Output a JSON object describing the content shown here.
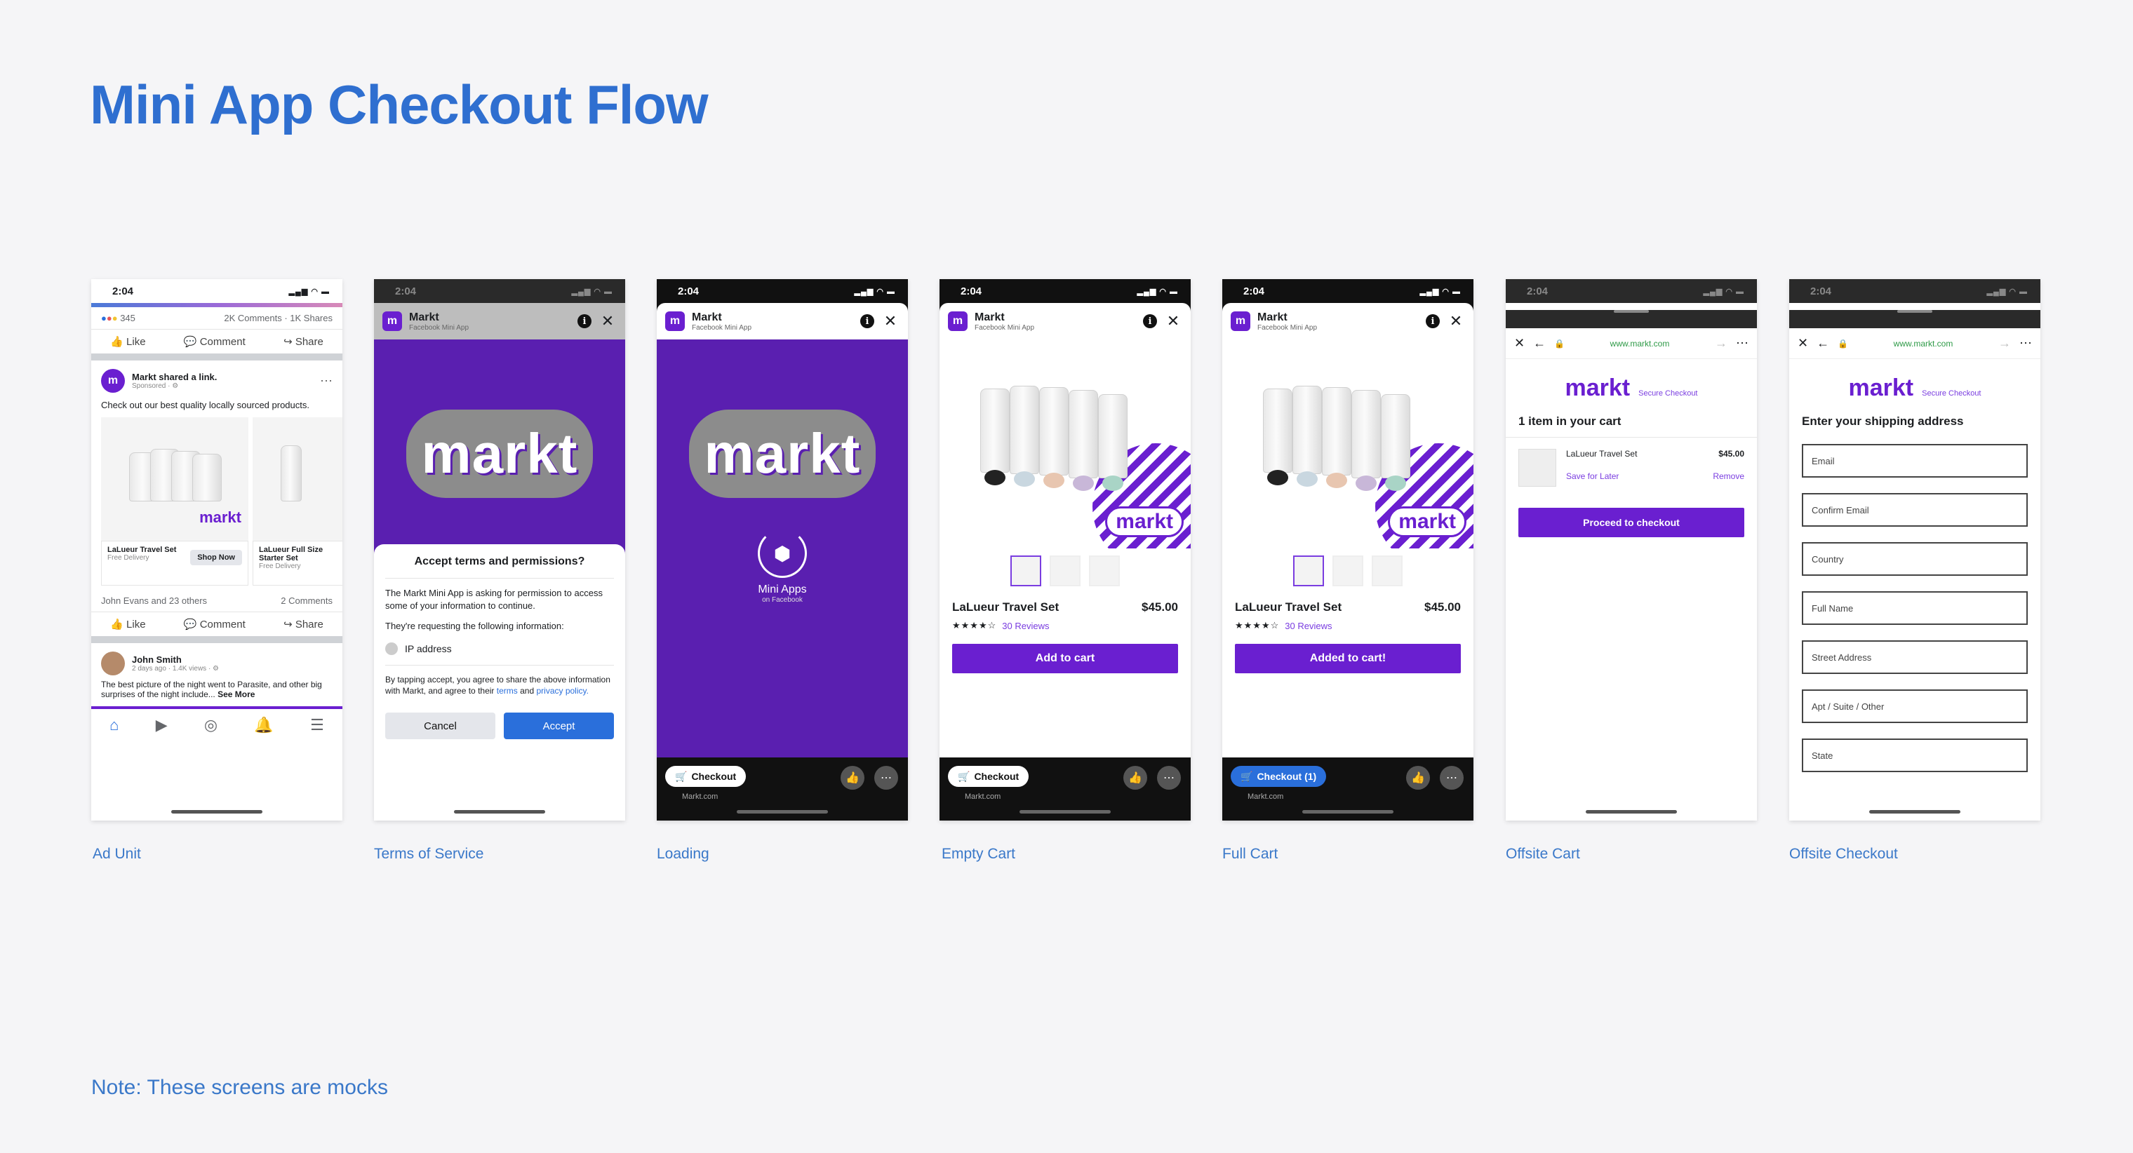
{
  "slide": {
    "title": "Mini App Checkout Flow",
    "note": "Note: These screens are mocks"
  },
  "colors": {
    "accent": "#2f6fd0",
    "brand_purple": "#6a1fd0",
    "fb_blue": "#2a6fdb"
  },
  "captions": [
    "Ad Unit",
    "Terms of Service",
    "Loading",
    "Empty Cart",
    "Full Cart",
    "Offsite Cart",
    "Offsite Checkout"
  ],
  "status_time": "2:04",
  "app": {
    "name": "Markt",
    "sub": "Facebook Mini App",
    "logo_text": "markt"
  },
  "ad": {
    "reactions": "345",
    "engagement": "2K Comments · 1K Shares",
    "actions": [
      "Like",
      "Comment",
      "Share"
    ],
    "poster": "Markt shared a link.",
    "sponsored": "Sponsored · ⚙",
    "post_text": "Check out our best quality locally sourced products.",
    "card1_name": "LaLueur Travel Set",
    "card1_ship": "Free Delivery",
    "card1_btn": "Shop Now",
    "card2_name": "LaLueur Full Size Starter Set",
    "card2_ship": "Free Delivery",
    "reactors": "John Evans and 23 others",
    "comments": "2 Comments",
    "person": "John Smith",
    "person_sub": "2 days ago · 1.4K views · ⚙",
    "person_text": "The best picture of the night went to Parasite, and other big surprises of the night include...",
    "see_more": "See More"
  },
  "terms": {
    "title": "Accept terms and permissions?",
    "p1": "The Markt Mini App is asking for permission to access some of your information to continue.",
    "p2": "They're requesting the following information:",
    "item": "IP address",
    "p3": "By tapping accept, you agree to share the above information with Markt, and agree to their",
    "terms_link": "terms",
    "and": "and",
    "privacy_link": "privacy policy.",
    "cancel": "Cancel",
    "accept": "Accept"
  },
  "loading": {
    "label": "Mini Apps",
    "sub": "on Facebook"
  },
  "product": {
    "name": "LaLueur Travel Set",
    "price": "$45.00",
    "stars": "★★★★☆",
    "reviews": "30 Reviews",
    "add_btn": "Add  to cart",
    "added_btn": "Added to cart!",
    "checkout": "Checkout",
    "checkout_full": "Checkout (1)",
    "site": "Markt.com"
  },
  "offsite": {
    "url": "www.markt.com",
    "secure": "Secure Checkout",
    "cart_title": "1 item in your cart",
    "item_name": "LaLueur Travel Set",
    "item_price": "$45.00",
    "save": "Save for Later",
    "remove": "Remove",
    "proceed": "Proceed to checkout",
    "ship_title": "Enter your shipping address",
    "fields": [
      "Email",
      "Confirm Email",
      "Country",
      "Full Name",
      "Street Address",
      "Apt / Suite / Other",
      "State"
    ]
  }
}
